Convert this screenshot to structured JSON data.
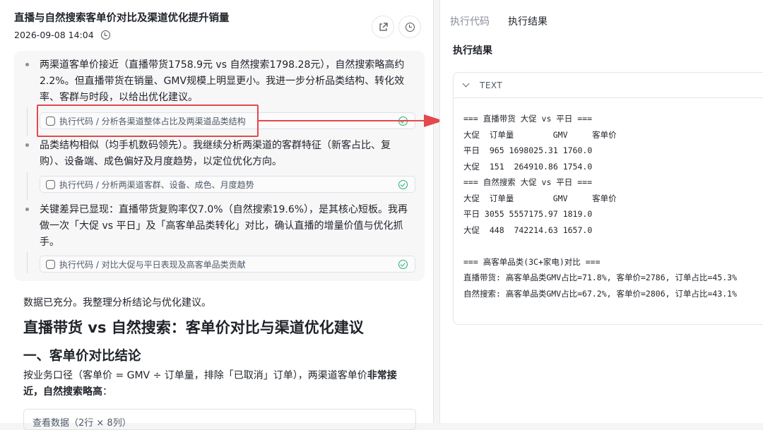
{
  "header": {
    "title": "直播与自然搜索客单价对比及渠道优化提升销量",
    "timestamp": "2026-09-08 14:04"
  },
  "steps": [
    {
      "text": "两渠道客单价接近（直播带货1758.9元 vs 自然搜索1798.28元），自然搜索略高约2.2%。但直播带货在销量、GMV规模上明显更小。我进一步分析品类结构、转化效率、客群与时段，以给出优化建议。",
      "chip": "执行代码 / 分析各渠道整体占比及两渠道品类结构"
    },
    {
      "text": "品类结构相似（均手机数码领先）。我继续分析两渠道的客群特征（新客占比、复购）、设备端、成色偏好及月度趋势，以定位优化方向。",
      "chip": "执行代码 / 分析两渠道客群、设备、成色、月度趋势"
    },
    {
      "text": "关键差异已显现：直播带货复购率仅7.0%（自然搜索19.6%），是其核心短板。我再做一次「大促 vs 平日」及「高客单品类转化」对比，确认直播的增量价值与优化抓手。",
      "chip": "执行代码 / 对比大促与平日表现及高客单品类贡献"
    }
  ],
  "main": {
    "intro": "数据已充分。我整理分析结论与优化建议。",
    "h1": "直播带货 vs 自然搜索：客单价对比与渠道优化建议",
    "h2": "一、客单价对比结论",
    "p_start": "按业务口径（客单价 = GMV ÷ 订单量，排除「已取消」订单），两渠道客单价",
    "p_bold": "非常接近，自然搜索略高",
    "p_end": "：",
    "data_toggle": "查看数据（2行 × 8列）"
  },
  "right": {
    "tabs": [
      "执行代码",
      "执行结果"
    ],
    "title": "执行结果",
    "output_type": "TEXT",
    "output_lines": [
      "=== 直播带货 大促 vs 平日 ===",
      "大促  订单量        GMV     客单价",
      "平日  965 1698025.31 1760.0",
      "大促  151  264910.86 1754.0",
      "=== 自然搜索 大促 vs 平日 ===",
      "大促  订单量        GMV     客单价",
      "平日 3055 5557175.97 1819.0",
      "大促  448  742214.63 1657.0",
      "",
      "=== 高客单品类(3C+家电)对比 ===",
      "直播带货: 高客单品类GMV占比=71.8%, 客单价=2786, 订单占比=45.3%",
      "自然搜索: 高客单品类GMV占比=67.2%, 客单价=2806, 订单占比=43.1%"
    ]
  }
}
